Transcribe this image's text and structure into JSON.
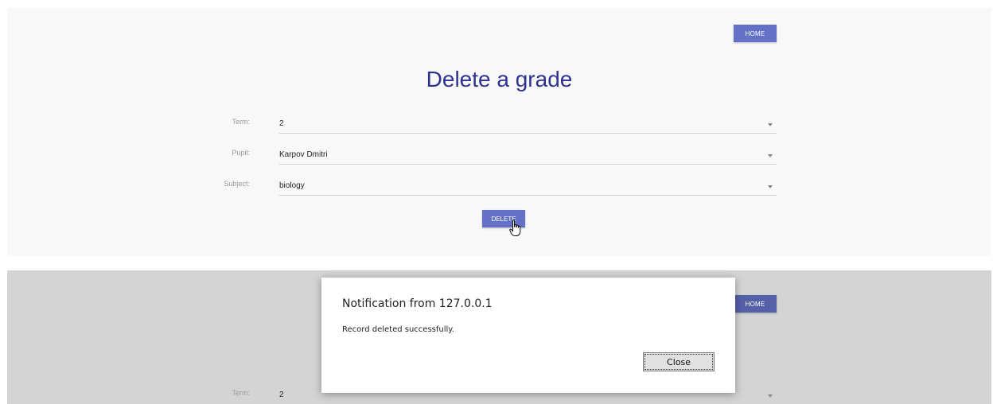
{
  "screen_before": {
    "home_label": "HOME",
    "title": "Delete a grade",
    "fields": [
      {
        "label": "Term:",
        "value": "2"
      },
      {
        "label": "Pupil:",
        "value": "Karpov Dmitri"
      },
      {
        "label": "Subject:",
        "value": "biology"
      }
    ],
    "delete_label": "DELETE"
  },
  "screen_after": {
    "home_label": "HOME",
    "term_label": "Term:",
    "term_value": "2",
    "dialog": {
      "title": "Notification from 127.0.0.1",
      "message": "Record deleted successfully.",
      "close_label": "Close"
    }
  },
  "colors": {
    "accent": "#6471c6",
    "title": "#2d3190",
    "panel_bg": "#f8f8f8",
    "overlay_bg": "#d4d4d4"
  },
  "icons": {
    "cursor": "hand-pointer-icon",
    "dropdown": "caret-down-icon"
  }
}
